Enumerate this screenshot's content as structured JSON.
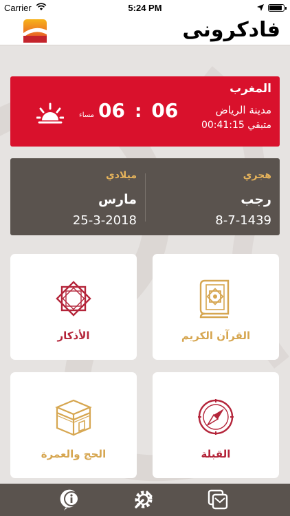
{
  "status_bar": {
    "carrier": "Carrier",
    "time": "5:24 PM"
  },
  "nav": {
    "brand": "فادكرونى"
  },
  "prayer": {
    "name": "المغرب",
    "city": "مدينة الرياض",
    "remaining": "متبقي 00:41:15",
    "hours": "06",
    "separator": ":",
    "minutes": "06",
    "period": "مساء"
  },
  "dates": {
    "hijri": {
      "label": "هجري",
      "month": "رجب",
      "value": "8-7-1439"
    },
    "gregorian": {
      "label": "ميلادي",
      "month": "مارس",
      "value": "25-3-2018"
    }
  },
  "tiles": {
    "quran": {
      "label": "القرآن الكريم",
      "icon": "quran-book-icon"
    },
    "azkar": {
      "label": "الأذكار",
      "icon": "octagram-star-icon"
    },
    "qibla": {
      "label": "القبلة",
      "icon": "compass-icon"
    },
    "hajj": {
      "label": "الحج والعمرة",
      "icon": "kaaba-icon"
    }
  },
  "bottom_bar": {
    "items": [
      "info-icon",
      "settings-gear-icon",
      "share-messages-icon"
    ]
  },
  "colors": {
    "prayer_card": "#d9112c",
    "date_card": "#5a534e",
    "gold": "#d6a650",
    "maroon": "#b4253a",
    "background": "#e6e3e1"
  }
}
